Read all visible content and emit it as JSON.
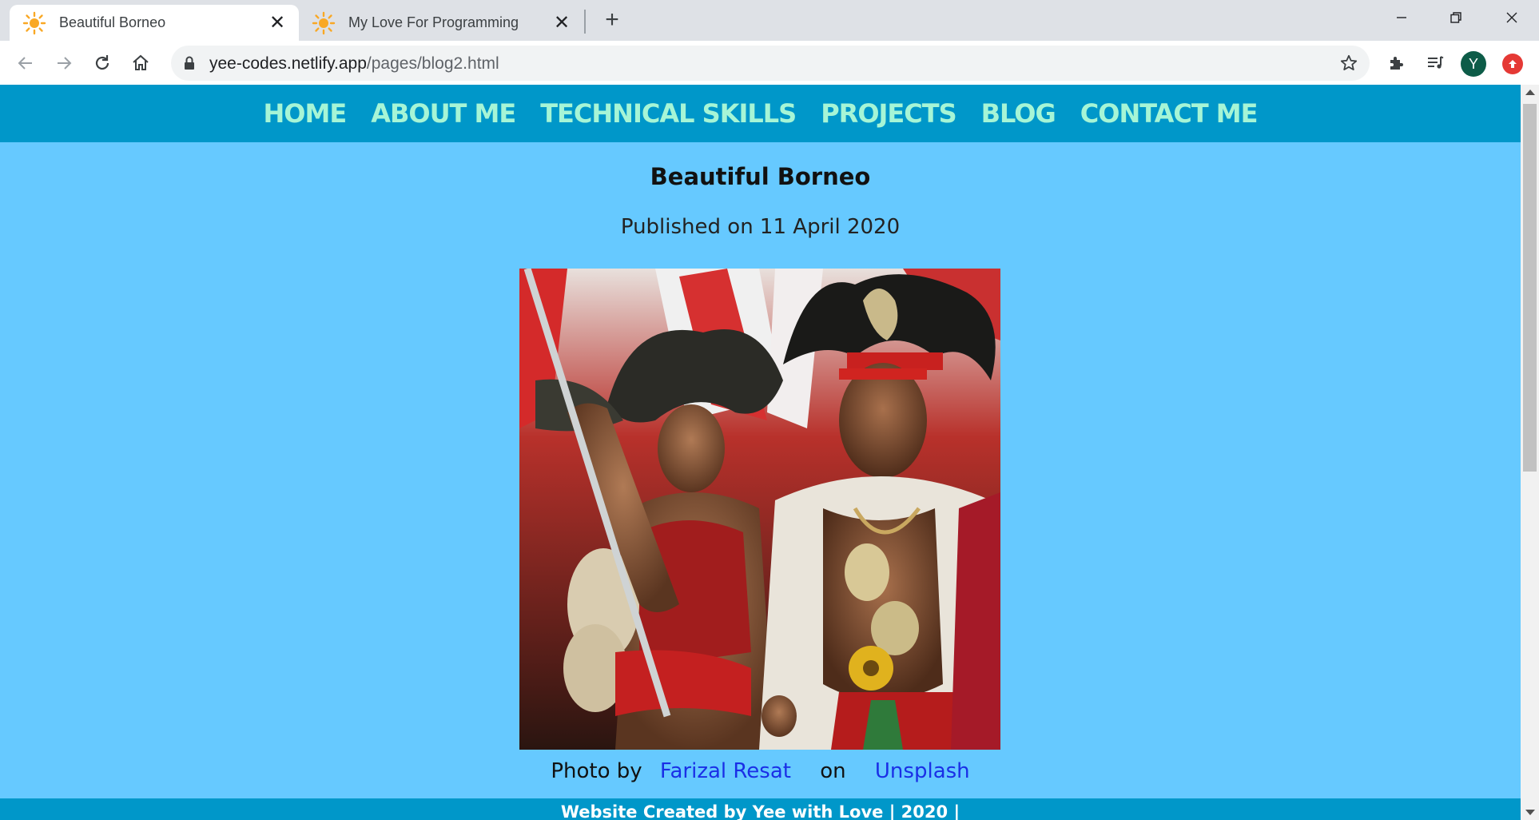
{
  "browser": {
    "tabs": [
      {
        "title": "Beautiful Borneo",
        "active": true,
        "favicon": "sun-icon"
      },
      {
        "title": "My Love For Programming",
        "active": false,
        "favicon": "sun-icon"
      }
    ],
    "url_domain": "yee-codes.netlify.app",
    "url_path": "/pages/blog2.html",
    "profile_initial": "Y"
  },
  "page": {
    "nav": [
      "HOME",
      "ABOUT ME",
      "TECHNICAL SKILLS",
      "PROJECTS",
      "BLOG",
      "CONTACT ME"
    ],
    "title": "Beautiful Borneo",
    "published": "Published on 11 April 2020",
    "credit": {
      "prefix": "Photo by",
      "author": "Farizal Resat",
      "middle": "on",
      "site": "Unsplash"
    },
    "footer": "Website Created by Yee with Love | 2020 |"
  },
  "colors": {
    "page_bg": "#66c9ff",
    "nav_bg": "#0097c9",
    "nav_text": "#a6f5d6",
    "link": "#1a2fe6"
  }
}
